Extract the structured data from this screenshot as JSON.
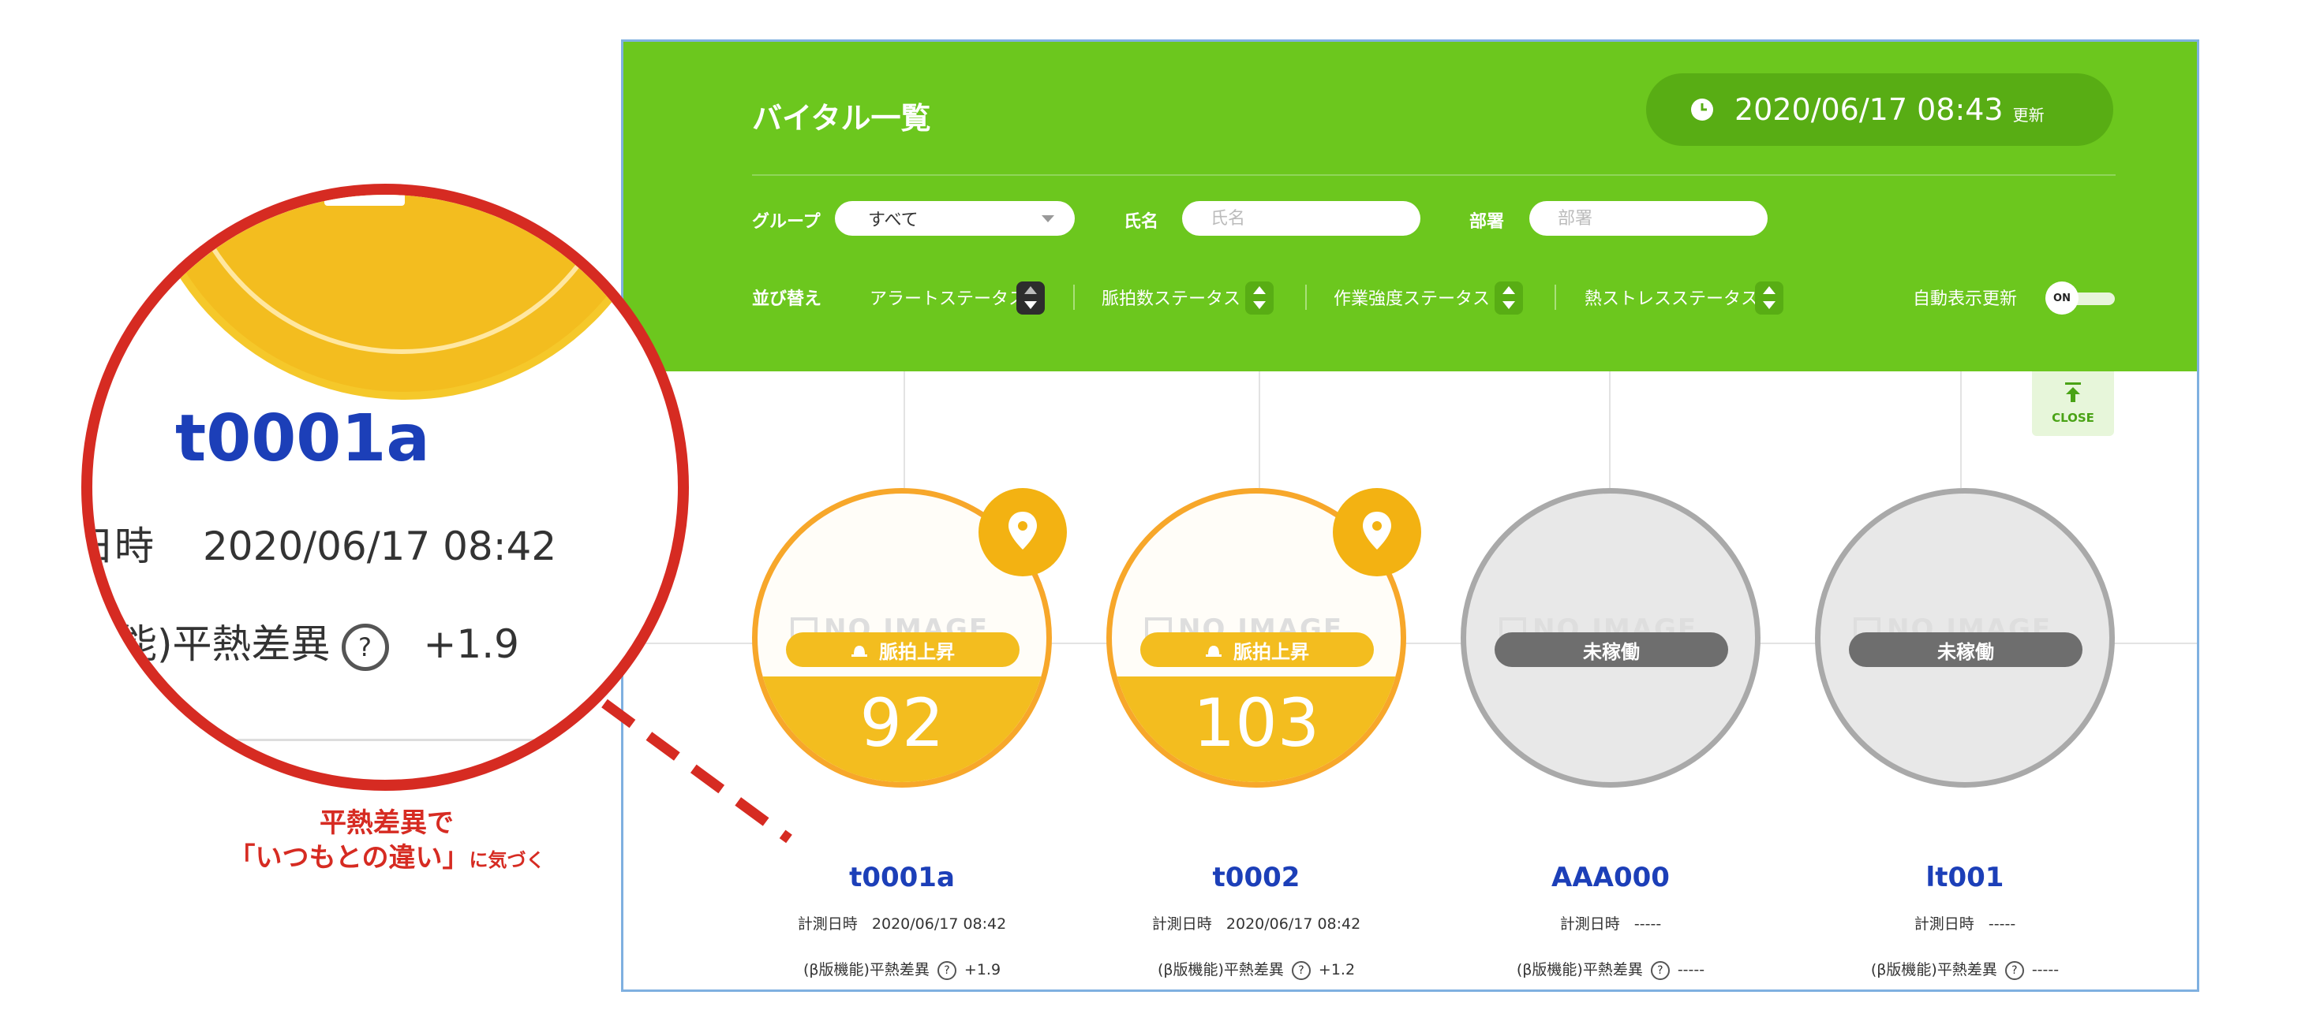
{
  "header": {
    "title": "バイタル一覧",
    "updated_datetime": "2020/06/17 08:43",
    "updated_suffix": "更新"
  },
  "filters": {
    "group_label": "グループ",
    "group_value": "すべて",
    "name_label": "氏名",
    "name_placeholder": "氏名",
    "dept_label": "部署",
    "dept_placeholder": "部署"
  },
  "sort": {
    "label": "並び替え",
    "options": [
      "アラートステータス",
      "脈拍数ステータス",
      "作業強度ステータス",
      "熱ストレスステータス"
    ]
  },
  "auto_refresh": {
    "label": "自動表示更新",
    "state": "ON"
  },
  "close_button": {
    "label": "CLOSE"
  },
  "no_image_text": "NO IMAGE",
  "cards": [
    {
      "id": "t0001a",
      "status": "脈拍上昇",
      "value": "92",
      "measured_label": "計測日時",
      "measured": "2020/06/17 08:42",
      "diff_label": "(β版機能)平熱差異",
      "diff": "+1.9"
    },
    {
      "id": "t0002",
      "status": "脈拍上昇",
      "value": "103",
      "measured_label": "計測日時",
      "measured": "2020/06/17 08:42",
      "diff_label": "(β版機能)平熱差異",
      "diff": "+1.2"
    },
    {
      "id": "AAA000",
      "status": "未稼働",
      "value": "",
      "measured_label": "計測日時",
      "measured": "-----",
      "diff_label": "(β版機能)平熱差異",
      "diff": "-----"
    },
    {
      "id": "lt001",
      "status": "未稼働",
      "value": "",
      "measured_label": "計測日時",
      "measured": "-----",
      "diff_label": "(β版機能)平熱差異",
      "diff": "-----"
    }
  ],
  "zoom": {
    "id": "t0001a",
    "measured_label": "日時",
    "measured": "2020/06/17 08:42",
    "diff_label": "機能)平熱差異",
    "diff": "+1.9"
  },
  "callout": {
    "line1": "平熱差異で",
    "line2_main": "「いつもとの違い」",
    "line2_small": "に気づく"
  },
  "colors": {
    "header_green": "#6cc71e",
    "alert_yellow": "#f3bd1f",
    "id_blue": "#1c3fb8",
    "callout_red": "#d62b22"
  }
}
